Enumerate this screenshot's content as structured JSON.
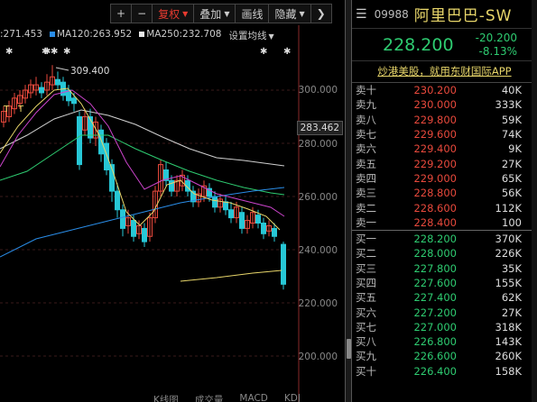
{
  "toolbar": {
    "plus_label": "+",
    "minus_label": "−",
    "adjust_label": "复权",
    "overlay_label": "叠加",
    "draw_label": "画线",
    "hide_label": "隐藏",
    "collapse_icon": "chevron-right-icon",
    "active_color": "#e83a2f"
  },
  "legend": {
    "ma60": ":271.453",
    "ma120": "MA120:263.952",
    "ma250": "MA250:232.708",
    "settings": "设置均线",
    "ma120_color": "#2a8de8",
    "ma250_color": "#e8e8e8"
  },
  "chart": {
    "high_marker": "309.400",
    "current_price_label": "283.462",
    "axis_labels": [
      "300.000",
      "280.000",
      "260.000",
      "240.000",
      "220.000",
      "200.000"
    ],
    "bottom_tabs": [
      "K线图",
      "成交量",
      "MACD",
      "KDJ"
    ]
  },
  "quote": {
    "code": "09988",
    "name": "阿里巴巴-SW",
    "price": "228.200",
    "change": "-20.200",
    "change_pct": "-8.13%",
    "ad_text": "炒港美股，就用东财国际APP",
    "asks": [
      {
        "label": "卖十",
        "price": "230.200",
        "vol": "40K",
        "dir": "up"
      },
      {
        "label": "卖九",
        "price": "230.000",
        "vol": "333K",
        "dir": "up"
      },
      {
        "label": "卖八",
        "price": "229.800",
        "vol": "59K",
        "dir": "up"
      },
      {
        "label": "卖七",
        "price": "229.600",
        "vol": "74K",
        "dir": "up"
      },
      {
        "label": "卖六",
        "price": "229.400",
        "vol": "9K",
        "dir": "up"
      },
      {
        "label": "卖五",
        "price": "229.200",
        "vol": "27K",
        "dir": "up"
      },
      {
        "label": "卖四",
        "price": "229.000",
        "vol": "65K",
        "dir": "up"
      },
      {
        "label": "卖三",
        "price": "228.800",
        "vol": "56K",
        "dir": "up"
      },
      {
        "label": "卖二",
        "price": "228.600",
        "vol": "112K",
        "dir": "up"
      },
      {
        "label": "卖一",
        "price": "228.400",
        "vol": "100",
        "dir": "up"
      }
    ],
    "bids": [
      {
        "label": "买一",
        "price": "228.200",
        "vol": "370K",
        "dir": "down"
      },
      {
        "label": "买二",
        "price": "228.000",
        "vol": "226K",
        "dir": "down"
      },
      {
        "label": "买三",
        "price": "227.800",
        "vol": "35K",
        "dir": "down"
      },
      {
        "label": "买四",
        "price": "227.600",
        "vol": "155K",
        "dir": "down"
      },
      {
        "label": "买五",
        "price": "227.400",
        "vol": "62K",
        "dir": "down"
      },
      {
        "label": "买六",
        "price": "227.200",
        "vol": "27K",
        "dir": "down"
      },
      {
        "label": "买七",
        "price": "227.000",
        "vol": "318K",
        "dir": "down"
      },
      {
        "label": "买八",
        "price": "226.800",
        "vol": "143K",
        "dir": "down"
      },
      {
        "label": "买九",
        "price": "226.600",
        "vol": "260K",
        "dir": "down"
      },
      {
        "label": "买十",
        "price": "226.400",
        "vol": "158K",
        "dir": "down"
      }
    ]
  },
  "colors": {
    "up": "#e8493c",
    "down": "#2ecc71",
    "name": "#e8d66a"
  }
}
